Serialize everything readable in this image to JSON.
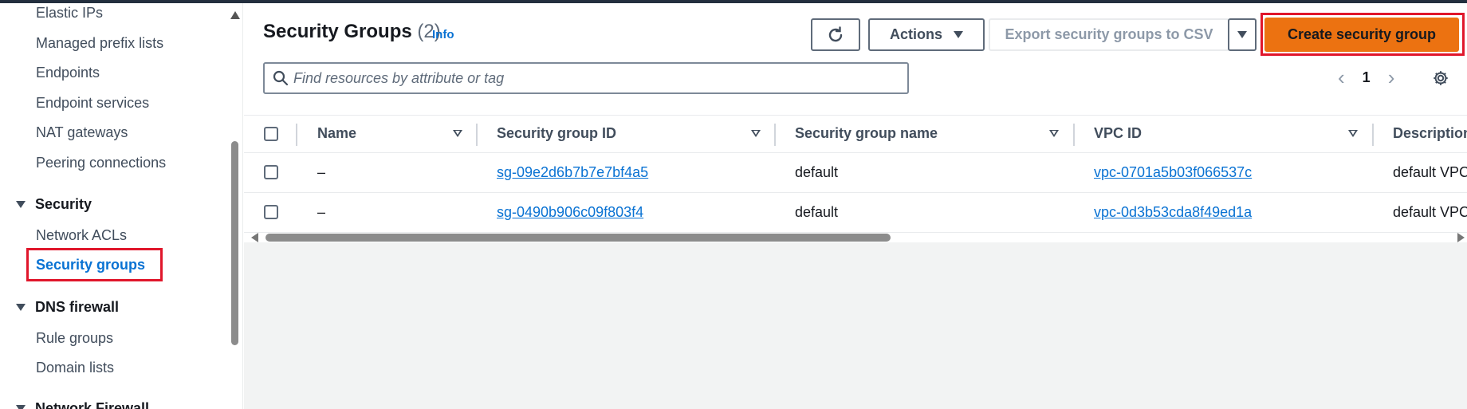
{
  "sidebar": {
    "items_top": [
      "Elastic IPs",
      "Managed prefix lists",
      "Endpoints",
      "Endpoint services",
      "NAT gateways",
      "Peering connections"
    ],
    "sections": [
      {
        "label": "Security",
        "items": [
          "Network ACLs",
          "Security groups"
        ]
      },
      {
        "label": "DNS firewall",
        "items": [
          "Rule groups",
          "Domain lists"
        ]
      },
      {
        "label": "Network Firewall"
      }
    ],
    "active_item": "Security groups"
  },
  "header": {
    "title": "Security Groups",
    "count": "(2)",
    "info": "Info"
  },
  "toolbar": {
    "refresh_icon": "refresh-icon",
    "actions_label": "Actions",
    "export_label": "Export security groups to CSV",
    "create_label": "Create security group"
  },
  "search": {
    "placeholder": "Find resources by attribute or tag",
    "value": ""
  },
  "pagination": {
    "current_page": "1"
  },
  "table": {
    "columns": [
      "Name",
      "Security group ID",
      "Security group name",
      "VPC ID",
      "Description"
    ],
    "rows": [
      {
        "name": "–",
        "sg_id": "sg-09e2d6b7b7e7bf4a5",
        "sg_name": "default",
        "vpc_id": "vpc-0701a5b03f066537c",
        "description": "default VPC"
      },
      {
        "name": "–",
        "sg_id": "sg-0490b906c09f803f4",
        "sg_name": "default",
        "vpc_id": "vpc-0d3b53cda8f49ed1a",
        "description": "default VPC"
      }
    ]
  },
  "colors": {
    "primary_button": "#ec7211",
    "link": "#0972d3",
    "highlight_box": "#e0162b"
  }
}
